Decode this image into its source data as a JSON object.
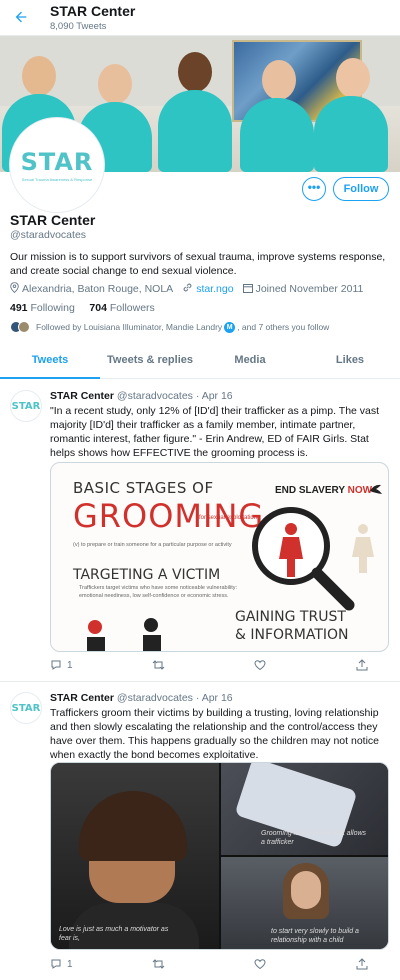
{
  "header": {
    "title": "STAR Center",
    "tweet_count": "8,090 Tweets"
  },
  "profile": {
    "avatar_text": "STAR",
    "avatar_subtext": "Sexual Trauma Awareness & Response",
    "more_label": "•••",
    "follow_label": "Follow",
    "name": "STAR Center",
    "handle": "@staradvocates",
    "bio": "Our mission is to support survivors of sexual trauma, improve systems response, and create social change to end sexual violence.",
    "location": "Alexandria, Baton Rouge, NOLA",
    "link": "star.ngo",
    "joined": "Joined November 2011",
    "following_count": "491",
    "following_label": "Following",
    "followers_count": "704",
    "followers_label": "Followers",
    "followed_by": "Followed by Louisiana Illuminator, Mandie Landry",
    "followed_by_suffix": ", and 7 others you follow",
    "badge_letter": "M"
  },
  "tabs": [
    {
      "label": "Tweets",
      "active": true
    },
    {
      "label": "Tweets & replies",
      "active": false
    },
    {
      "label": "Media",
      "active": false
    },
    {
      "label": "Likes",
      "active": false
    }
  ],
  "tweets": [
    {
      "name": "STAR Center",
      "handle": "@staradvocates",
      "date": "· Apr 16",
      "text": "\"In a recent study, only 12% of [ID'd] their trafficker as a pimp. The vast majority [ID'd] their trafficker as a family member, intimate partner, romantic interest, father figure.\" - Erin Andrew, ED of FAIR Girls. Stat helps shows how EFFECTIVE the grooming process is.",
      "reply_count": "1",
      "retweet_count": "",
      "like_count": "",
      "image": {
        "line1": "BASIC STAGES OF",
        "line2": "GROOMING",
        "sub": "for sexual exploitation",
        "definition": "(v) to prepare or train someone for a particular purpose or activity",
        "heading1": "TARGETING A VICTIM",
        "heading1_desc": "Traffickers target victims who have some noticeable vulnerability: emotional neediness, low self-confidence or economic stress.",
        "heading2_line1": "GAINING TRUST",
        "heading2_line2": "& INFORMATION",
        "brand_main": "END SLAVERY",
        "brand_accent": "NOW"
      }
    },
    {
      "name": "STAR Center",
      "handle": "@staradvocates",
      "date": "· Apr 16",
      "text": "Traffickers groom their victims by building a trusting, loving relationship and then slowly escalating the relationship and the control/access they have over them. This happens gradually so the children may not notice when exactly the bond becomes exploitative.",
      "reply_count": "1",
      "retweet_count": "",
      "like_count": "",
      "video_captions": {
        "left": "Love is just as much a motivator as fear is,",
        "top_right": "Grooming is a process that allows a trafficker",
        "bottom_right": "to start very slowly to build a relationship with a child"
      }
    }
  ],
  "colors": {
    "accent": "#1da1f2",
    "brand_teal": "#4fc3c8",
    "grooming_red": "#d0312d"
  }
}
